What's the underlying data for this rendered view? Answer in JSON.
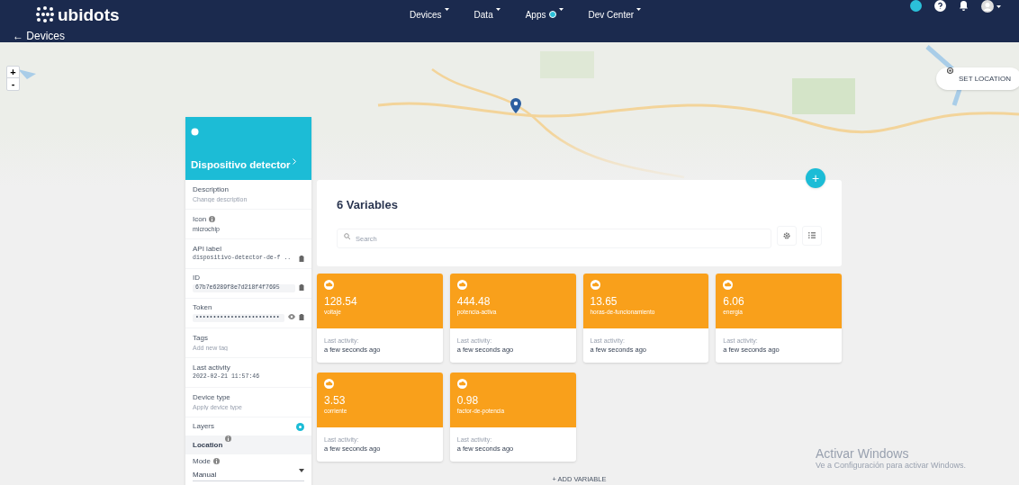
{
  "header": {
    "logo": "ubidots",
    "nav": [
      {
        "label": "Devices",
        "dropdown": true,
        "badge": false
      },
      {
        "label": "Data",
        "dropdown": true,
        "badge": false
      },
      {
        "label": "Apps",
        "dropdown": true,
        "badge": true
      },
      {
        "label": "Dev Center",
        "dropdown": true,
        "badge": false
      }
    ]
  },
  "breadcrumb": {
    "back": "← Devices"
  },
  "map": {
    "zoom_in": "+",
    "zoom_out": "-",
    "set_location": "SET LOCATION",
    "add": "+"
  },
  "device": {
    "name": "Dispositivo detector",
    "fields": [
      {
        "kind": "input",
        "label": "Description",
        "info": false,
        "placeholder": "Change description",
        "copy": false,
        "reveal": false
      },
      {
        "kind": "text",
        "label": "Icon",
        "info": true,
        "value": "microchip",
        "copy": false,
        "reveal": false
      },
      {
        "kind": "code",
        "label": "API label",
        "info": false,
        "value": "dispositivo-detector-de-f ..",
        "copy": true,
        "reveal": false
      },
      {
        "kind": "boxed",
        "label": "ID",
        "info": false,
        "value": "67b7e6289f8e7d218f4f7695",
        "copy": true,
        "reveal": false
      },
      {
        "kind": "boxed",
        "label": "Token",
        "info": false,
        "value": "••••••••••••••••••••••••",
        "copy": true,
        "reveal": true
      },
      {
        "kind": "input",
        "label": "Tags",
        "info": false,
        "placeholder": "Add new tag",
        "copy": false,
        "reveal": false
      },
      {
        "kind": "code",
        "label": "Last activity",
        "info": false,
        "value": "2022-02-21 11:57:46",
        "copy": false,
        "reveal": false
      },
      {
        "kind": "input",
        "label": "Device type",
        "info": false,
        "placeholder": "Apply device type",
        "copy": false,
        "reveal": false
      }
    ],
    "layers": {
      "label": "Layers",
      "on": true
    },
    "location": {
      "label": "Location"
    },
    "mode": {
      "label": "Mode",
      "value": "Manual"
    }
  },
  "variables": {
    "title": "6 Variables",
    "search_placeholder": "Search",
    "add": "+ ADD VARIABLE",
    "items": [
      {
        "value": "128.54",
        "name": "voltaje",
        "activity_label": "Last activity:",
        "activity": "a few seconds ago"
      },
      {
        "value": "444.48",
        "name": "potencia-activa",
        "activity_label": "Last activity:",
        "activity": "a few seconds ago"
      },
      {
        "value": "13.65",
        "name": "horas-de-funcionamiento",
        "activity_label": "Last activity:",
        "activity": "a few seconds ago"
      },
      {
        "value": "6.06",
        "name": "energia",
        "activity_label": "Last activity:",
        "activity": "a few seconds ago"
      },
      {
        "value": "3.53",
        "name": "corriente",
        "activity_label": "Last activity:",
        "activity": "a few seconds ago"
      },
      {
        "value": "0.98",
        "name": "factor-de-potencia",
        "activity_label": "Last activity:",
        "activity": "a few seconds ago"
      }
    ]
  },
  "windows_notice": {
    "title": "Activar Windows",
    "text": "Ve a Configuración para activar Windows."
  }
}
